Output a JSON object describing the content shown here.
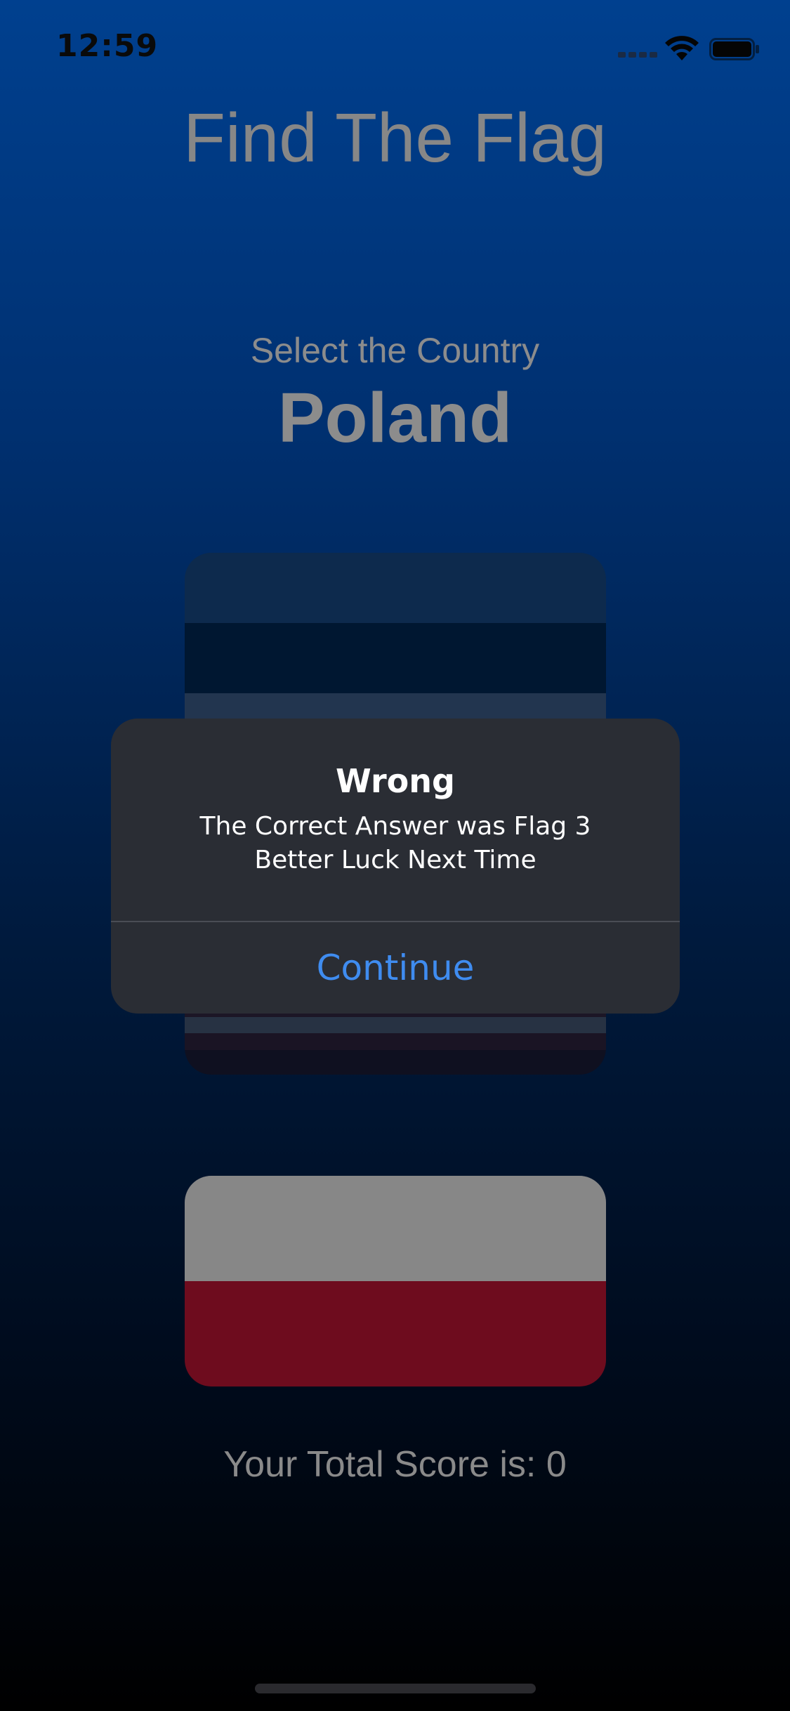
{
  "status_bar": {
    "time": "12:59",
    "signal_icon": "cellular-signal-icon",
    "wifi_icon": "wifi-icon",
    "battery_icon": "battery-icon"
  },
  "game": {
    "title": "Find The Flag",
    "prompt": "Select the Country",
    "country": "Poland",
    "score_text": "Your Total Score is: 0"
  },
  "alert": {
    "title": "Wrong",
    "message_line1": "The Correct Answer was Flag 3",
    "message_line2": "Better Luck Next Time",
    "button_label": "Continue"
  },
  "colors": {
    "background_top": "#00408f",
    "background_bottom": "#000000",
    "alert_background": "#2a2d34",
    "alert_button": "#3f8cf0",
    "poland_white_dimmed": "#878787",
    "poland_red_dimmed": "#6e0c1e"
  }
}
